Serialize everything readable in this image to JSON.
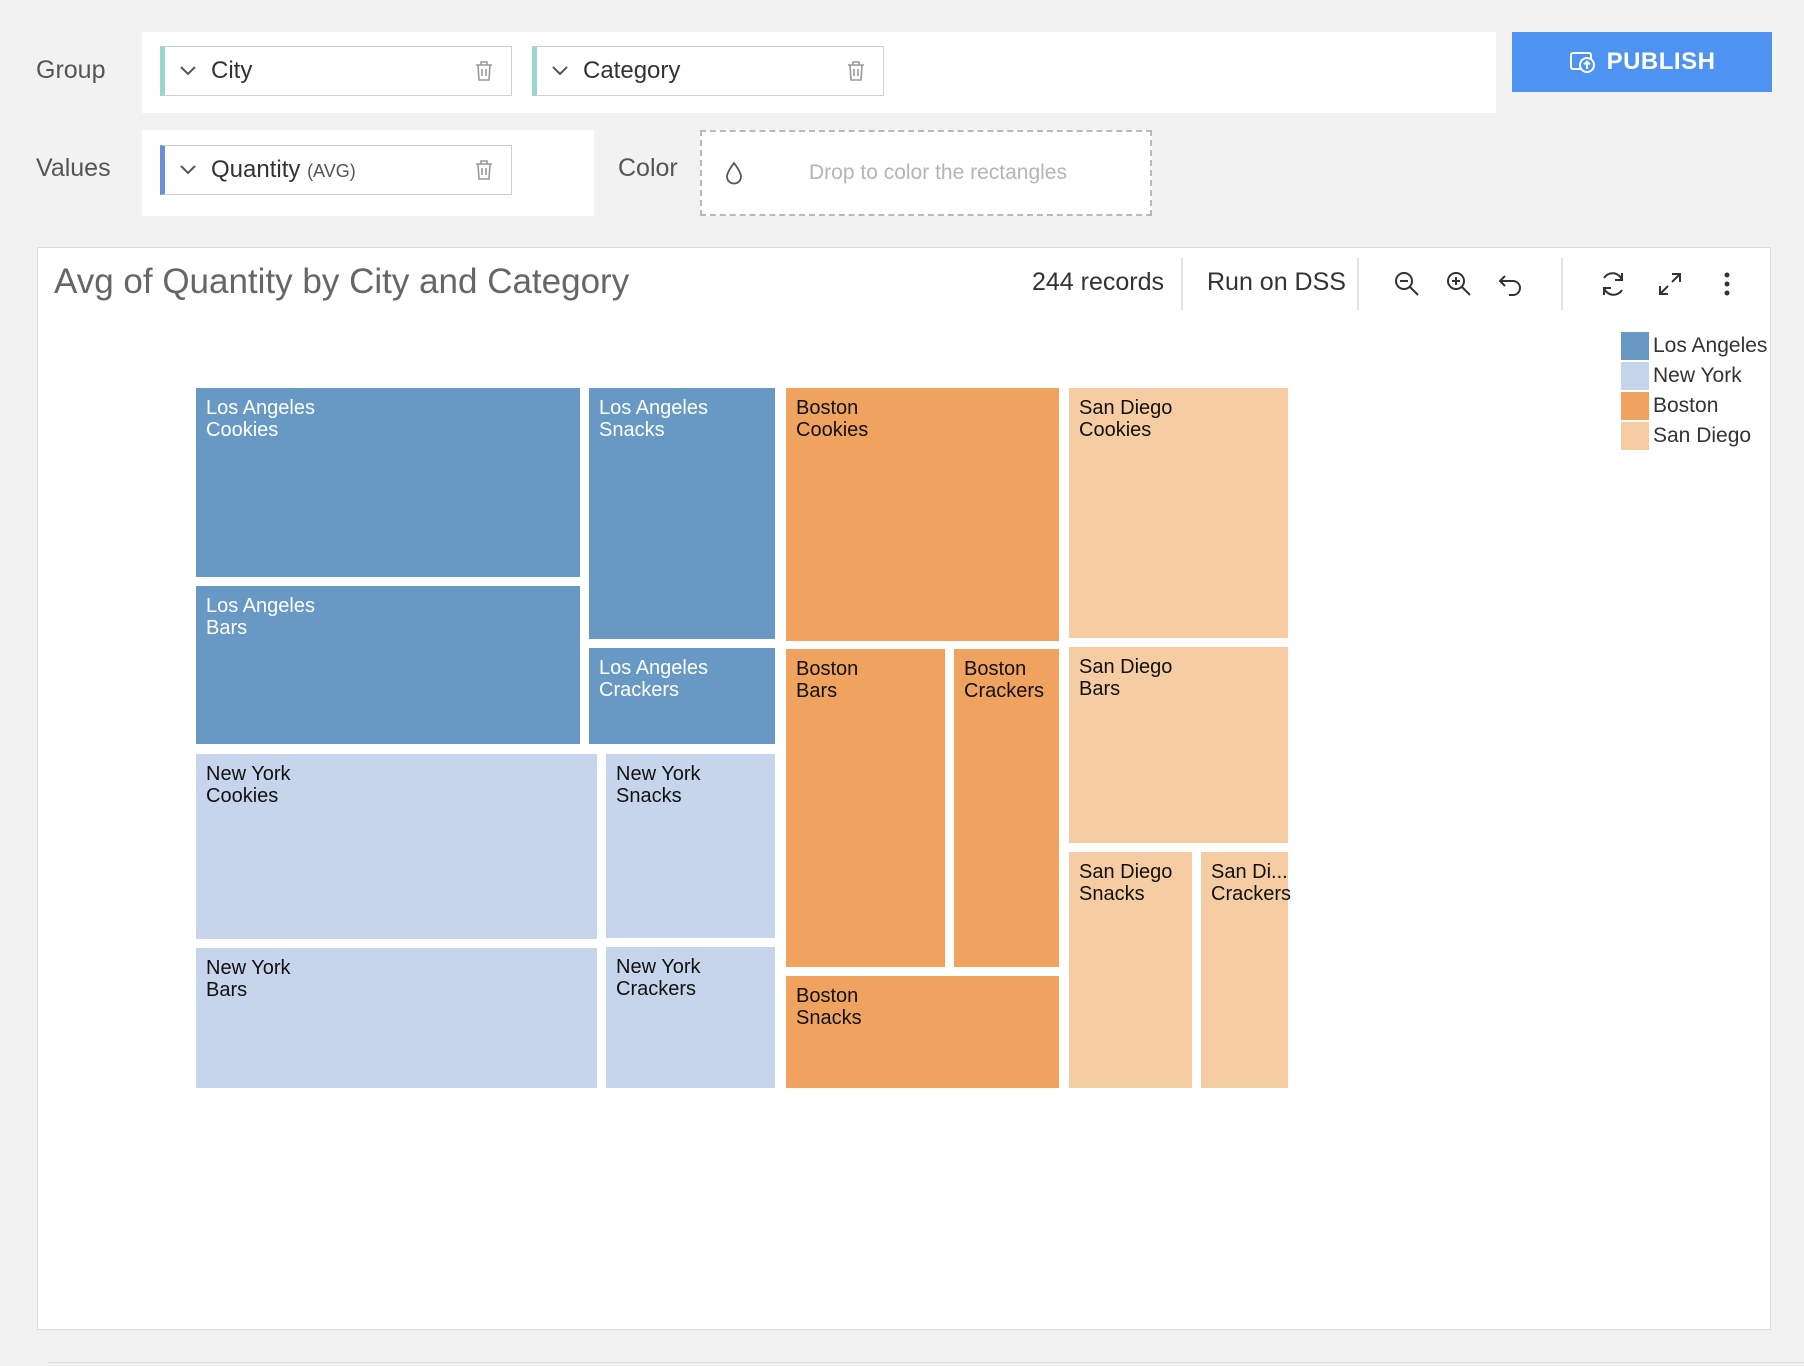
{
  "controls": {
    "group_label": "Group",
    "values_label": "Values",
    "color_label": "Color",
    "group_fields": [
      "City",
      "Category"
    ],
    "value_field": "Quantity",
    "value_agg": "(AVG)",
    "color_placeholder": "Drop to color the rectangles",
    "publish_label": "PUBLISH"
  },
  "toolbar": {
    "records": "244 records",
    "run_label": "Run on DSS"
  },
  "colors": {
    "Los Angeles": "#6899c4",
    "New York": "#c6d5eb",
    "Boston": "#f0a35e",
    "San Diego": "#f6cda2",
    "publish": "#4e93f1"
  },
  "chart_data": {
    "type": "treemap",
    "title": "Avg of Quantity by City and Category",
    "legend": [
      "Los Angeles",
      "New York",
      "Boston",
      "San Diego"
    ],
    "legend_position": "top-right",
    "cities": [
      {
        "name": "Los Angeles",
        "text_color": "#ffffff",
        "items": [
          {
            "category": "Cookies",
            "value": 16.0
          },
          {
            "category": "Snacks",
            "value": 10.4
          },
          {
            "category": "Bars",
            "value": 13.4
          },
          {
            "category": "Crackers",
            "value": 4.0
          }
        ]
      },
      {
        "name": "New York",
        "text_color": "#111111",
        "items": [
          {
            "category": "Cookies",
            "value": 16.5
          },
          {
            "category": "Snacks",
            "value": 6.8
          },
          {
            "category": "Bars",
            "value": 12.4
          },
          {
            "category": "Crackers",
            "value": 5.0
          }
        ]
      },
      {
        "name": "Boston",
        "text_color": "#111111",
        "items": [
          {
            "category": "Cookies",
            "value": 15.3
          },
          {
            "category": "Bars",
            "value": 11.0
          },
          {
            "category": "Crackers",
            "value": 7.4
          },
          {
            "category": "Snacks",
            "value": 6.9
          }
        ]
      },
      {
        "name": "San Diego",
        "text_color": "#111111",
        "items": [
          {
            "category": "Cookies",
            "value": 12.2
          },
          {
            "category": "Bars",
            "value": 9.4
          },
          {
            "category": "Snacks",
            "value": 6.6
          },
          {
            "category": "Crackers",
            "value": 4.6
          }
        ]
      }
    ],
    "labels": {
      "San Diego|Crackers": "San Di..."
    }
  }
}
